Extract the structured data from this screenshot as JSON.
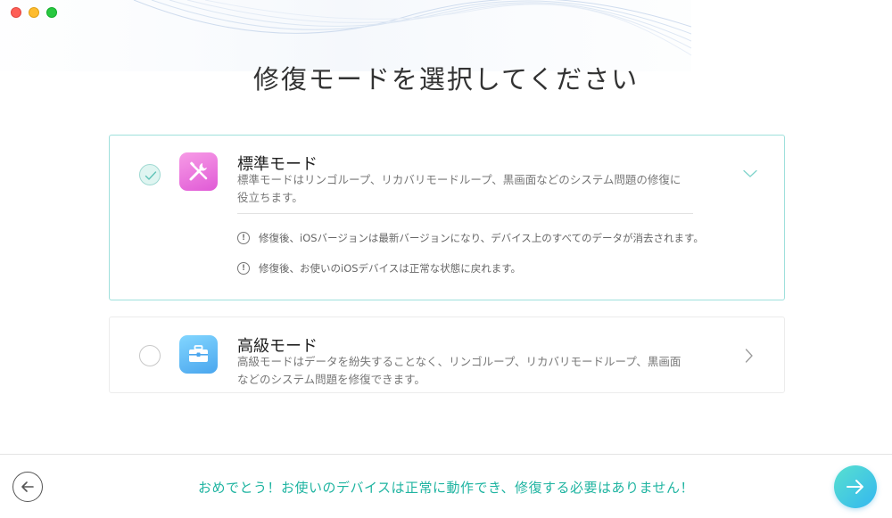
{
  "window": {
    "title": "修復モードを選択してください"
  },
  "modes": [
    {
      "id": "standard",
      "title": "標準モード",
      "description": "標準モードはリンゴループ、リカバリモードループ、黒画面などのシステム問題の修復に役立ちます。",
      "selected": true,
      "expanded": true,
      "icon": "tools-icon",
      "icon_color": "#e05ad6",
      "notes": [
        "修復後、iOSバージョンは最新バージョンになり、デバイス上のすべてのデータが消去されます。",
        "修復後、お使いのiOSデバイスは正常な状態に戻れます。"
      ]
    },
    {
      "id": "advanced",
      "title": "高級モード",
      "description": "高級モードはデータを紛失することなく、リンゴループ、リカバリモードループ、黒画面などのシステム問題を修復できます。",
      "selected": false,
      "expanded": false,
      "icon": "toolbox-icon",
      "icon_color": "#4aa6ee"
    }
  ],
  "footer": {
    "status_message": "おめでとう！お使いのデバイスは正常に動作でき、修復する必要はありません！",
    "back_icon": "arrow-left-icon",
    "next_icon": "arrow-right-icon"
  },
  "colors": {
    "accent": "#1fb4a1",
    "selected_border": "#9fe0dc"
  }
}
